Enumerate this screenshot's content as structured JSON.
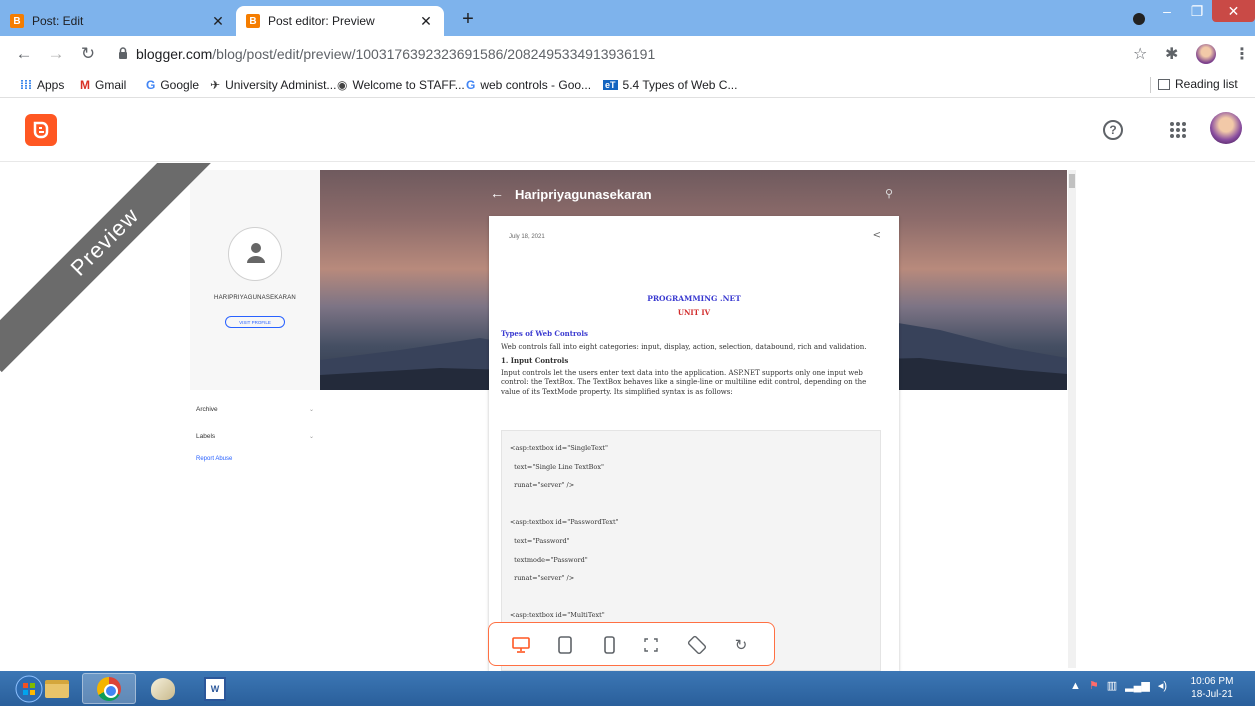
{
  "browser": {
    "tabs": [
      {
        "title": "Post: Edit",
        "favicon": "blogger-icon"
      },
      {
        "title": "Post editor: Preview",
        "favicon": "blogger-icon"
      }
    ],
    "url_domain": "blogger.com",
    "url_path": "/blog/post/edit/preview/1003176392323691586/2082495334913936191",
    "bookmarks": [
      {
        "label": "Apps",
        "icon": "apps-grid-icon"
      },
      {
        "label": "Gmail",
        "icon": "gmail-icon"
      },
      {
        "label": "Google",
        "icon": "google-icon"
      },
      {
        "label": "University Administ...",
        "icon": "university-icon"
      },
      {
        "label": "Welcome to STAFF...",
        "icon": "globe-icon"
      },
      {
        "label": "web controls - Goo...",
        "icon": "google-icon"
      },
      {
        "label": "5.4 Types of Web C...",
        "icon": "document-icon"
      }
    ],
    "reading_list": "Reading list"
  },
  "blogger": {
    "brand_color": "#ff5722",
    "ribbon": "Preview"
  },
  "blog": {
    "name": "Haripriyagunasekaran",
    "profile_name": "HARIPRIYAGUNASEKARAN",
    "visit_profile": "VISIT PROFILE",
    "sidebar_items": [
      "Archive",
      "Labels"
    ],
    "report_abuse": "Report Abuse"
  },
  "post": {
    "date": "July 18, 2021",
    "heading": "PROGRAMMING .NET",
    "unit": "UNIT IV",
    "section_title": "Types of Web Controls",
    "intro": "Web controls fall into eight categories: input, display, action, selection, databound, rich and validation.",
    "sub1": "1. Input Controls",
    "para1": "Input controls let the users enter text data into the application. ASP.NET supports only one input web control: the TextBox. The TextBox behaves like a single-line or multiline edit control, depending on the value of its TextMode property. Its simplified syntax is as follows:",
    "code_lines": [
      "<asp:textbox id=\"SingleText\"",
      "  text=\"Single Line TextBox\"",
      "  runat=\"server\" />",
      "",
      "<asp:textbox id=\"PasswordText\"",
      "  text=\"Password\"",
      "  textmode=\"Password\"",
      "  runat=\"server\" />",
      "",
      "<asp:textbox id=\"MultiText\""
    ]
  },
  "device_toolbar": [
    "desktop-icon",
    "tablet-icon",
    "phone-icon",
    "fullscreen-icon",
    "rotate-icon",
    "refresh-icon"
  ],
  "taskbar": {
    "time": "10:06 PM",
    "date": "18-Jul-21"
  }
}
